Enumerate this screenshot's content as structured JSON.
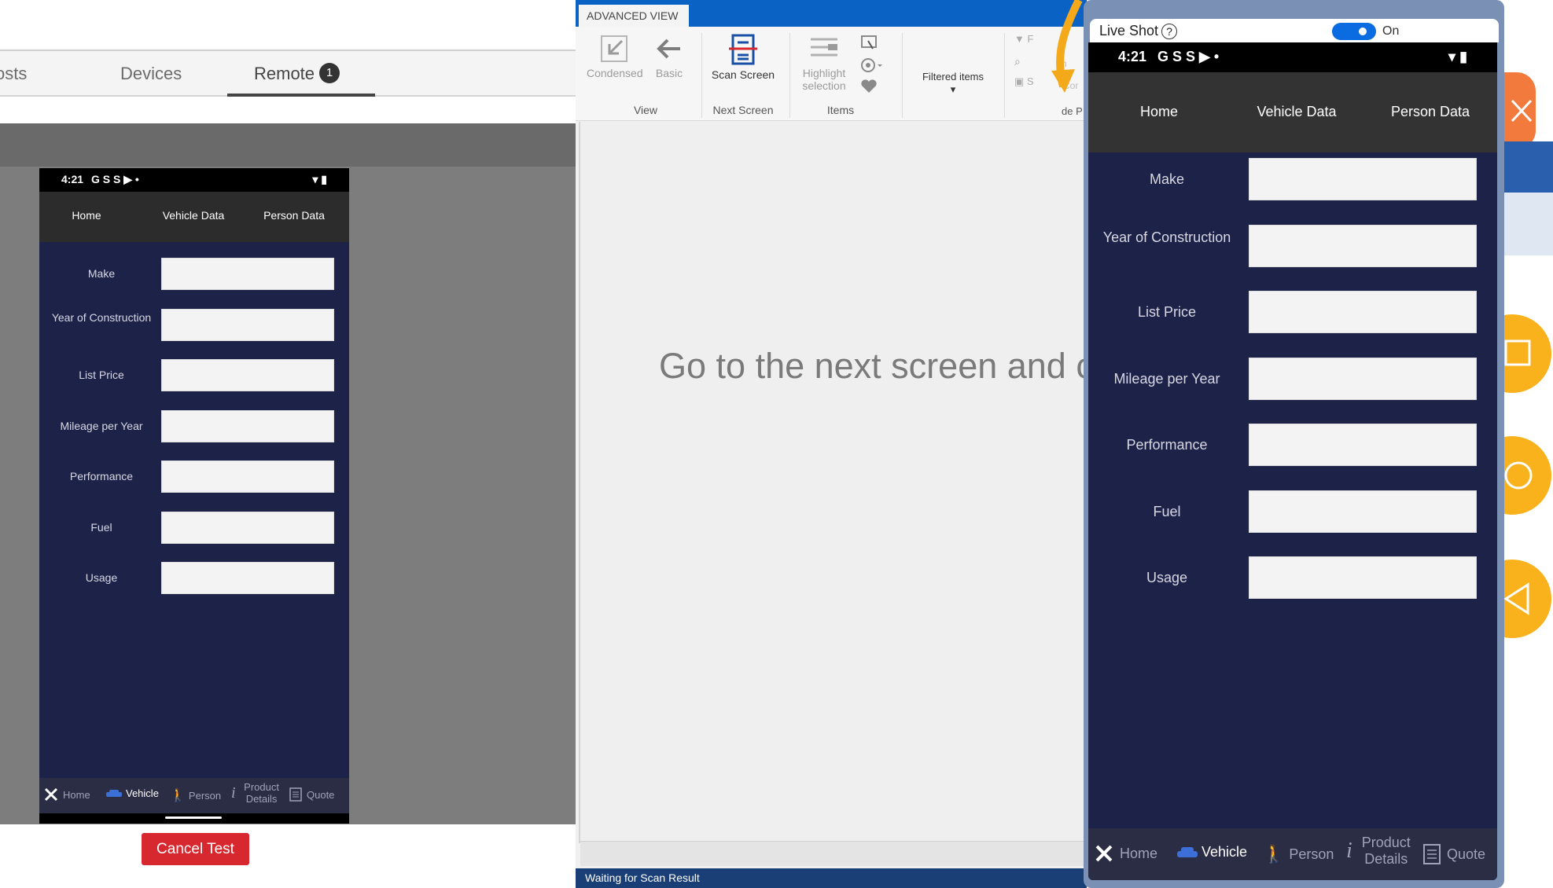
{
  "left_panel": {
    "tabs": [
      {
        "label": "osts",
        "active": false
      },
      {
        "label": "Devices",
        "active": false
      },
      {
        "label": "Remote",
        "active": true,
        "badge": "1"
      }
    ],
    "cancel_button": "Cancel Test"
  },
  "phone": {
    "status": {
      "time": "4:21",
      "icons_left": "G  S  S  ▶  •",
      "icons_right": "▾ ▮"
    },
    "nav": [
      "Home",
      "Vehicle Data",
      "Person Data"
    ],
    "fields": [
      {
        "label": "Make",
        "value": ""
      },
      {
        "label": "Year of Construction",
        "value": ""
      },
      {
        "label": "List Price",
        "value": ""
      },
      {
        "label": "Mileage per Year",
        "value": ""
      },
      {
        "label": "Performance",
        "value": ""
      },
      {
        "label": "Fuel",
        "value": ""
      },
      {
        "label": "Usage",
        "value": ""
      }
    ],
    "tabbar": [
      {
        "label": "Home",
        "icon": "logo-icon",
        "active": false
      },
      {
        "label": "Vehicle",
        "icon": "car-icon",
        "active": true
      },
      {
        "label": "Person",
        "icon": "person-icon",
        "active": false
      },
      {
        "label": "Product Details",
        "icon": "info-icon",
        "active": false
      },
      {
        "label": "Quote",
        "icon": "document-icon",
        "active": false
      }
    ]
  },
  "ribbon": {
    "tab_label": "ADVANCED VIEW",
    "buttons": {
      "condensed": "Condensed",
      "basic": "Basic",
      "scan_screen": "Scan Screen",
      "highlight_selection": "Highlight selection",
      "filtered_items": "Filtered items ▾"
    },
    "groups": {
      "view": "View",
      "next_screen": "Next Screen",
      "items": "Items"
    },
    "partial": {
      "a": "F",
      "b": "h",
      "c": "S",
      "d": "Cor",
      "e": "de P"
    }
  },
  "main": {
    "hint": "Go to the next screen and cli",
    "status_text": "Waiting for Scan Result"
  },
  "live_shot": {
    "title": "Live Shot",
    "help": "?",
    "toggle_label": "On",
    "toggle_on": true
  },
  "colors": {
    "phone_bg": "#1d2249",
    "cancel_red": "#d7282f",
    "ribbon_blue": "#0b62c5",
    "accent_orange": "#f9b21c"
  }
}
